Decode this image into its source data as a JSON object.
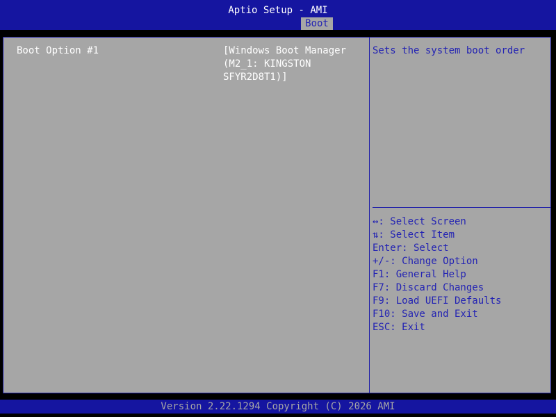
{
  "app": {
    "title": "Aptio Setup - AMI",
    "tabs": [
      {
        "label": "Boot",
        "active": true
      }
    ]
  },
  "settings": [
    {
      "label": "Boot Option #1",
      "value_lines": [
        "[Windows Boot Manager",
        "(M2_1: KINGSTON",
        "SFYR2D8T1)]"
      ]
    }
  ],
  "help": {
    "description": "Sets the system boot order"
  },
  "keys": [
    "↔: Select Screen",
    "⇅: Select Item",
    "Enter: Select",
    "+/-: Change Option",
    "F1: General Help",
    "F7: Discard Changes",
    "F9: Load UEFI Defaults",
    "F10: Save and Exit",
    "ESC: Exit"
  ],
  "footer": {
    "version": "Version 2.22.1294 Copyright (C) 2026 AMI"
  },
  "colors": {
    "header_bg": "#1515a0",
    "panel_bg": "#a6a6a6",
    "highlight_text": "#ffffff",
    "help_text": "#2323b3"
  }
}
